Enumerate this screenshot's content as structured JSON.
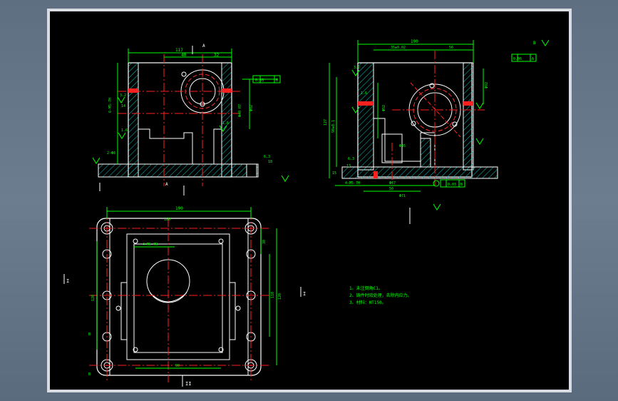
{
  "drawing": {
    "background": "#000000",
    "colors": {
      "outline": "#ffffff",
      "dim": "#00ff00",
      "center": "#ff2020",
      "hatch": "#00c8c8",
      "gear": "#ff3030"
    },
    "front_view": {
      "dims": {
        "overall_width": "117",
        "bore_offset": "40",
        "right_part": "32",
        "bore_dia": "Φ92",
        "bore_fit": "Φ40 H7",
        "wall_thk": "14",
        "hole_spec": "6-M5-7H",
        "slot": "2-Φ8",
        "base": "18"
      },
      "roughness": [
        "3.2",
        "1.6",
        "1.6",
        "6.3"
      ],
      "tolerance": [
        "0.03",
        "B"
      ],
      "section_labels": [
        "A",
        "A"
      ]
    },
    "side_view": {
      "dims": {
        "total_width": "190",
        "bore_center": "35±0.02",
        "right_offset": "56",
        "height_total": "127",
        "bore_height": "90±0.1",
        "bore_dia": "Φ92",
        "bore_inner": "Φ52",
        "flange": "13",
        "base_h": "15",
        "bottom_w": "50",
        "bottom_w2": "Φ71",
        "small_hole": "Φ67",
        "pocket": "Φ45"
      },
      "roughness": [
        "3.2",
        "1.6",
        "6.3"
      ],
      "tolerance_top": [
        "0.06",
        "A"
      ],
      "tolerance_bottom": [
        "0.03",
        "B"
      ],
      "note_spec": "4-M5-7H",
      "label": "B"
    },
    "top_view": {
      "dims": {
        "outer_width": "190",
        "inner_width": "160",
        "height_left": "120",
        "height_inner": "90",
        "bottom_dim": "90",
        "right_a": "30",
        "right_b": "110",
        "side": "120"
      },
      "hole_spec": "4-M5-7H",
      "labels": [
        "B",
        "B"
      ]
    },
    "notes": {
      "line1": "1、未注倒角C1。",
      "line2": "2、铸件时效处理，去除内应力。",
      "line3": "3、材料：HT150。"
    },
    "markers": {
      "left": "I",
      "right": "I",
      "bottom": "II",
      "top_right": "B"
    }
  }
}
